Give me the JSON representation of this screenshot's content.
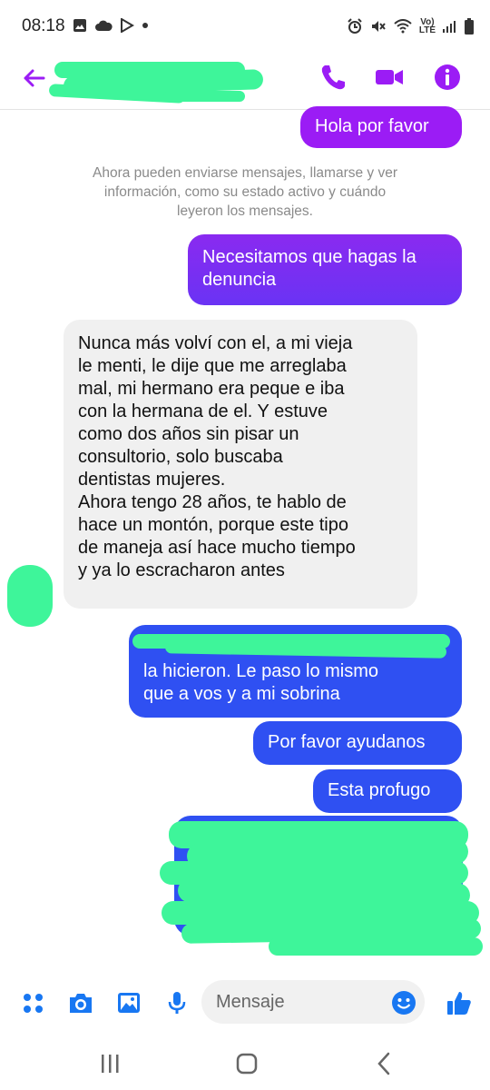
{
  "status_bar": {
    "time": "08:18",
    "volte_top": "Vo)",
    "volte_bottom": "LTE"
  },
  "header": {
    "back_icon": "arrow-left-icon",
    "call_icon": "phone-icon",
    "video_icon": "video-camera-icon",
    "info_icon": "info-icon",
    "accent_color": "#9b1cf5"
  },
  "conversation": {
    "system_note": "Ahora pueden enviarse mensajes, llamarse y ver\ninformación, como su estado activo y cuándo\nleyeron los mensajes.",
    "messages": [
      {
        "sender": "me",
        "text": "Hola por favor"
      },
      {
        "sender": "me",
        "text": "Necesitamos que hagas la\ndenuncia"
      },
      {
        "sender": "other",
        "text": "Nunca más volví con el, a mi vieja\nle menti, le dije que me arreglaba\nmal, mi hermano era peque e iba\ncon la hermana de el. Y estuve\ncomo dos años sin pisar un\nconsultorio, solo buscaba\ndentistas mujeres.\nAhora tengo 28 años, te hablo de\nhace un montón, porque este tipo\nde maneja así hace mucho tiempo\ny ya lo escracharon antes"
      },
      {
        "sender": "me",
        "text": "la hicieron. Le paso lo mismo\nque a vos y a mi sobrina"
      },
      {
        "sender": "me",
        "text": "Por favor ayudanos"
      },
      {
        "sender": "me",
        "text": "Esta profugo"
      }
    ]
  },
  "composer": {
    "placeholder": "Mensaje",
    "icons": [
      "menu-dots-icon",
      "camera-icon",
      "gallery-icon",
      "microphone-icon",
      "emoji-icon",
      "thumbs-up-icon"
    ]
  },
  "colors": {
    "outgoing_purple": "#9b1cf5",
    "outgoing_blue": "#2f50f2",
    "incoming_grey": "#f0f0f0",
    "redaction_green": "#3ef59a",
    "composer_blue": "#1877f2"
  }
}
